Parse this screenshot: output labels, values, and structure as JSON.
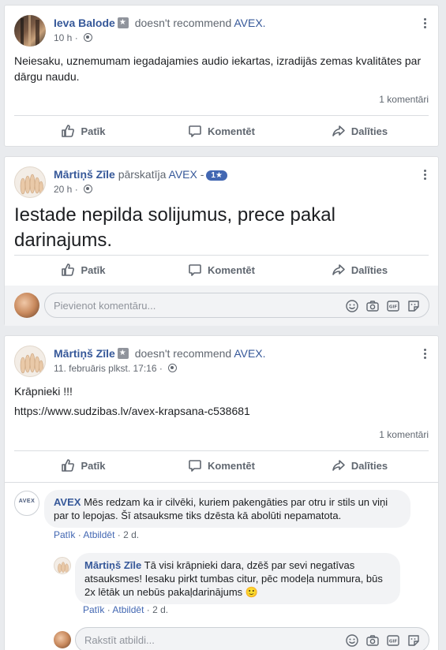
{
  "posts": [
    {
      "author": "Ieva Balode",
      "action": "doesn't recommend",
      "target": "AVEX.",
      "time": "10 h",
      "text": "Neiesaku, uznemumam iegadajamies audio iekartas, izradijās zemas kvalitātes par dārgu naudu.",
      "comments_count": "1 komentāri"
    },
    {
      "author": "Mārtiņš Zīle",
      "action": "pārskatīja",
      "target": "AVEX",
      "separator": "-",
      "rating": "1★",
      "time": "20 h",
      "text": "Iestade nepilda solijumus, prece pakal darinajums."
    },
    {
      "author": "Mārtiņš Zīle",
      "action": "doesn't recommend",
      "target": "AVEX.",
      "time": "11. februāris plkst. 17:16",
      "text": "Krāpnieki !!!",
      "link": "https://www.sudzibas.lv/avex-krapsana-c538681",
      "comments_count": "1 komentāri"
    }
  ],
  "actions": {
    "like": "Patīk",
    "comment": "Komentēt",
    "share": "Dalīties"
  },
  "comment_input_placeholder": "Pievienot komentāru...",
  "reply_input_placeholder": "Rakstīt atbildi...",
  "comments": [
    {
      "author": "AVEX",
      "text": "Mēs redzam ka ir cilvēki, kuriem pakengāties par otru ir stils un viņi par to lepojas. Šī atsauksme tiks dzēsta kā abolūti nepamatota.",
      "like": "Patīk",
      "reply": "Atbildēt",
      "time": "2 d."
    },
    {
      "author": "Mārtiņš Zīle",
      "text": "Tā visi krāpnieki dara, dzēš par sevi negatīvas atsauksmes! Iesaku pirkt tumbas citur, pēc modeļa nummura, būs 2x lētāk un nebūs pakaļdarinājums",
      "emoji": "🙂",
      "like": "Patīk",
      "reply": "Atbildēt",
      "time": "2 d."
    }
  ],
  "avex_logo_text": "AVEX",
  "colors": {
    "link": "#365899",
    "badge": "#4267b2",
    "background": "#e9ebee"
  }
}
